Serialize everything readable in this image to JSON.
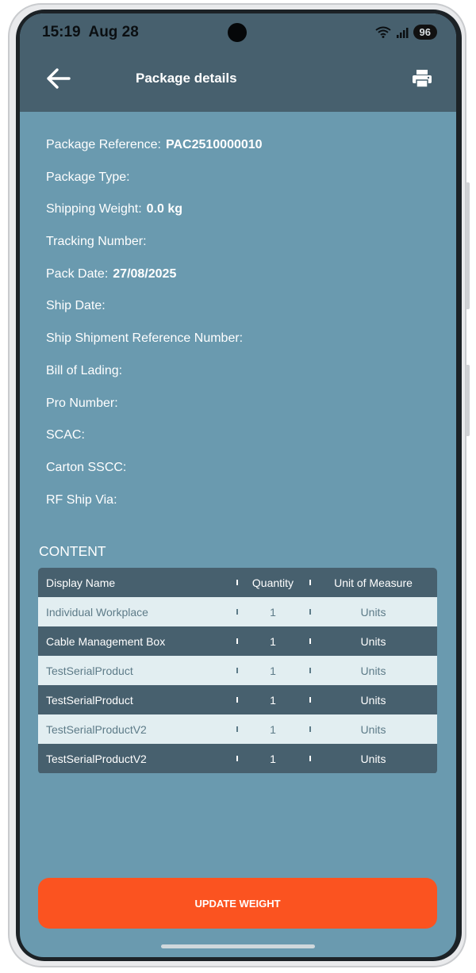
{
  "status": {
    "time": "15:19",
    "date": "Aug 28",
    "battery": "96",
    "icons": [
      "wifi-icon",
      "signal-icon",
      "battery-icon"
    ]
  },
  "appbar": {
    "title": "Package details",
    "back_icon": "arrow-left-icon",
    "print_icon": "printer-icon"
  },
  "details": [
    {
      "label": "Package Reference:",
      "value": "PAC2510000010"
    },
    {
      "label": "Package Type:",
      "value": ""
    },
    {
      "label": "Shipping Weight:",
      "value": "0.0 kg"
    },
    {
      "label": "Tracking Number:",
      "value": ""
    },
    {
      "label": "Pack Date:",
      "value": "27/08/2025"
    },
    {
      "label": "Ship Date:",
      "value": ""
    },
    {
      "label": "Ship Shipment Reference Number:",
      "value": ""
    },
    {
      "label": "Bill of Lading:",
      "value": ""
    },
    {
      "label": "Pro Number:",
      "value": ""
    },
    {
      "label": "SCAC:",
      "value": ""
    },
    {
      "label": "Carton SSCC:",
      "value": ""
    },
    {
      "label": "RF Ship Via:",
      "value": ""
    }
  ],
  "content": {
    "heading": "CONTENT",
    "columns": [
      "Display Name",
      "Quantity",
      "Unit of Measure"
    ],
    "rows": [
      {
        "name": "Individual Workplace",
        "quantity": "1",
        "unit": "Units"
      },
      {
        "name": "Cable Management Box",
        "quantity": "1",
        "unit": "Units"
      },
      {
        "name": "TestSerialProduct",
        "quantity": "1",
        "unit": "Units"
      },
      {
        "name": "TestSerialProduct",
        "quantity": "1",
        "unit": "Units"
      },
      {
        "name": "TestSerialProductV2",
        "quantity": "1",
        "unit": "Units"
      },
      {
        "name": "TestSerialProductV2",
        "quantity": "1",
        "unit": "Units"
      }
    ]
  },
  "actions": {
    "update_weight": "UPDATE WEIGHT"
  },
  "colors": {
    "background": "#6a9aaf",
    "header": "#47606e",
    "row_light": "#e2eef1",
    "accent": "#fb5320"
  }
}
